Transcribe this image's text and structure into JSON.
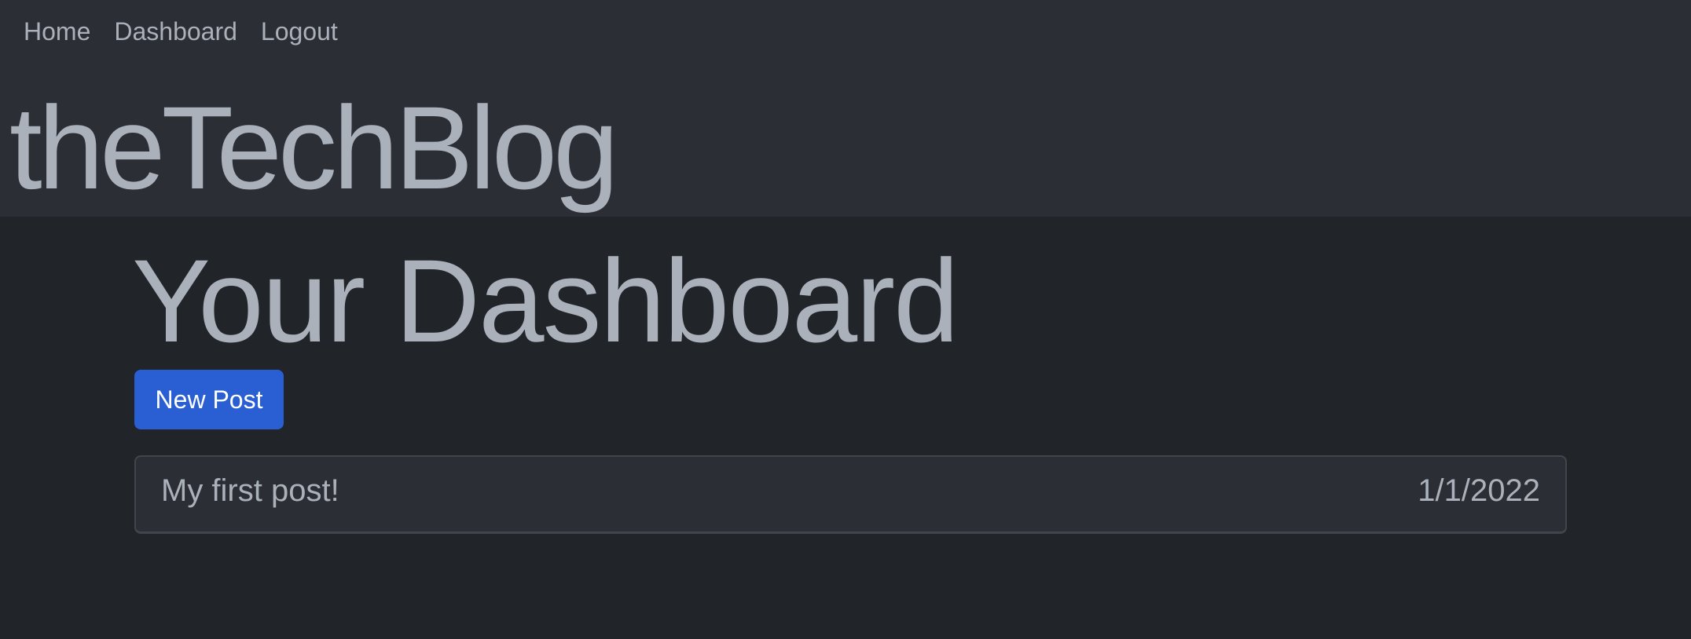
{
  "nav": {
    "items": [
      {
        "label": "Home"
      },
      {
        "label": "Dashboard"
      },
      {
        "label": "Logout"
      }
    ]
  },
  "brand": {
    "title": "theTechBlog"
  },
  "main": {
    "title": "Your Dashboard",
    "new_post_label": "New Post",
    "posts": [
      {
        "title": "My first post!",
        "date": "1/1/2022"
      }
    ]
  },
  "colors": {
    "page_background": "#212429",
    "header_background": "#2b2e34",
    "text": "#aab1bb",
    "primary_button": "#2a5fd3",
    "card_border": "#41454c"
  }
}
